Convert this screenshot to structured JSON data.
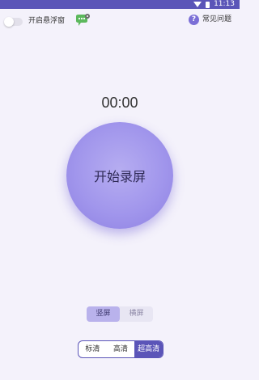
{
  "status_bar": {
    "time": "11:13",
    "background": "#5b55b8"
  },
  "header": {
    "float_window_label": "开启悬浮窗",
    "float_window_enabled": false,
    "faq_label": "常见问题"
  },
  "timer": {
    "value": "00:00"
  },
  "record": {
    "label": "开始录屏"
  },
  "orientation": {
    "options": [
      "竖屏",
      "横屏"
    ],
    "selected": "竖屏"
  },
  "quality": {
    "options": [
      "标清",
      "高清",
      "超高清"
    ],
    "selected": "超高清"
  },
  "icons": {
    "wifi": "wifi-icon",
    "battery": "battery-icon",
    "chat": "chat-bubble-icon",
    "help": "question-mark-icon"
  },
  "colors": {
    "accent": "#5b55b8",
    "button": "#a196ec",
    "background": "#f4f2fb"
  }
}
